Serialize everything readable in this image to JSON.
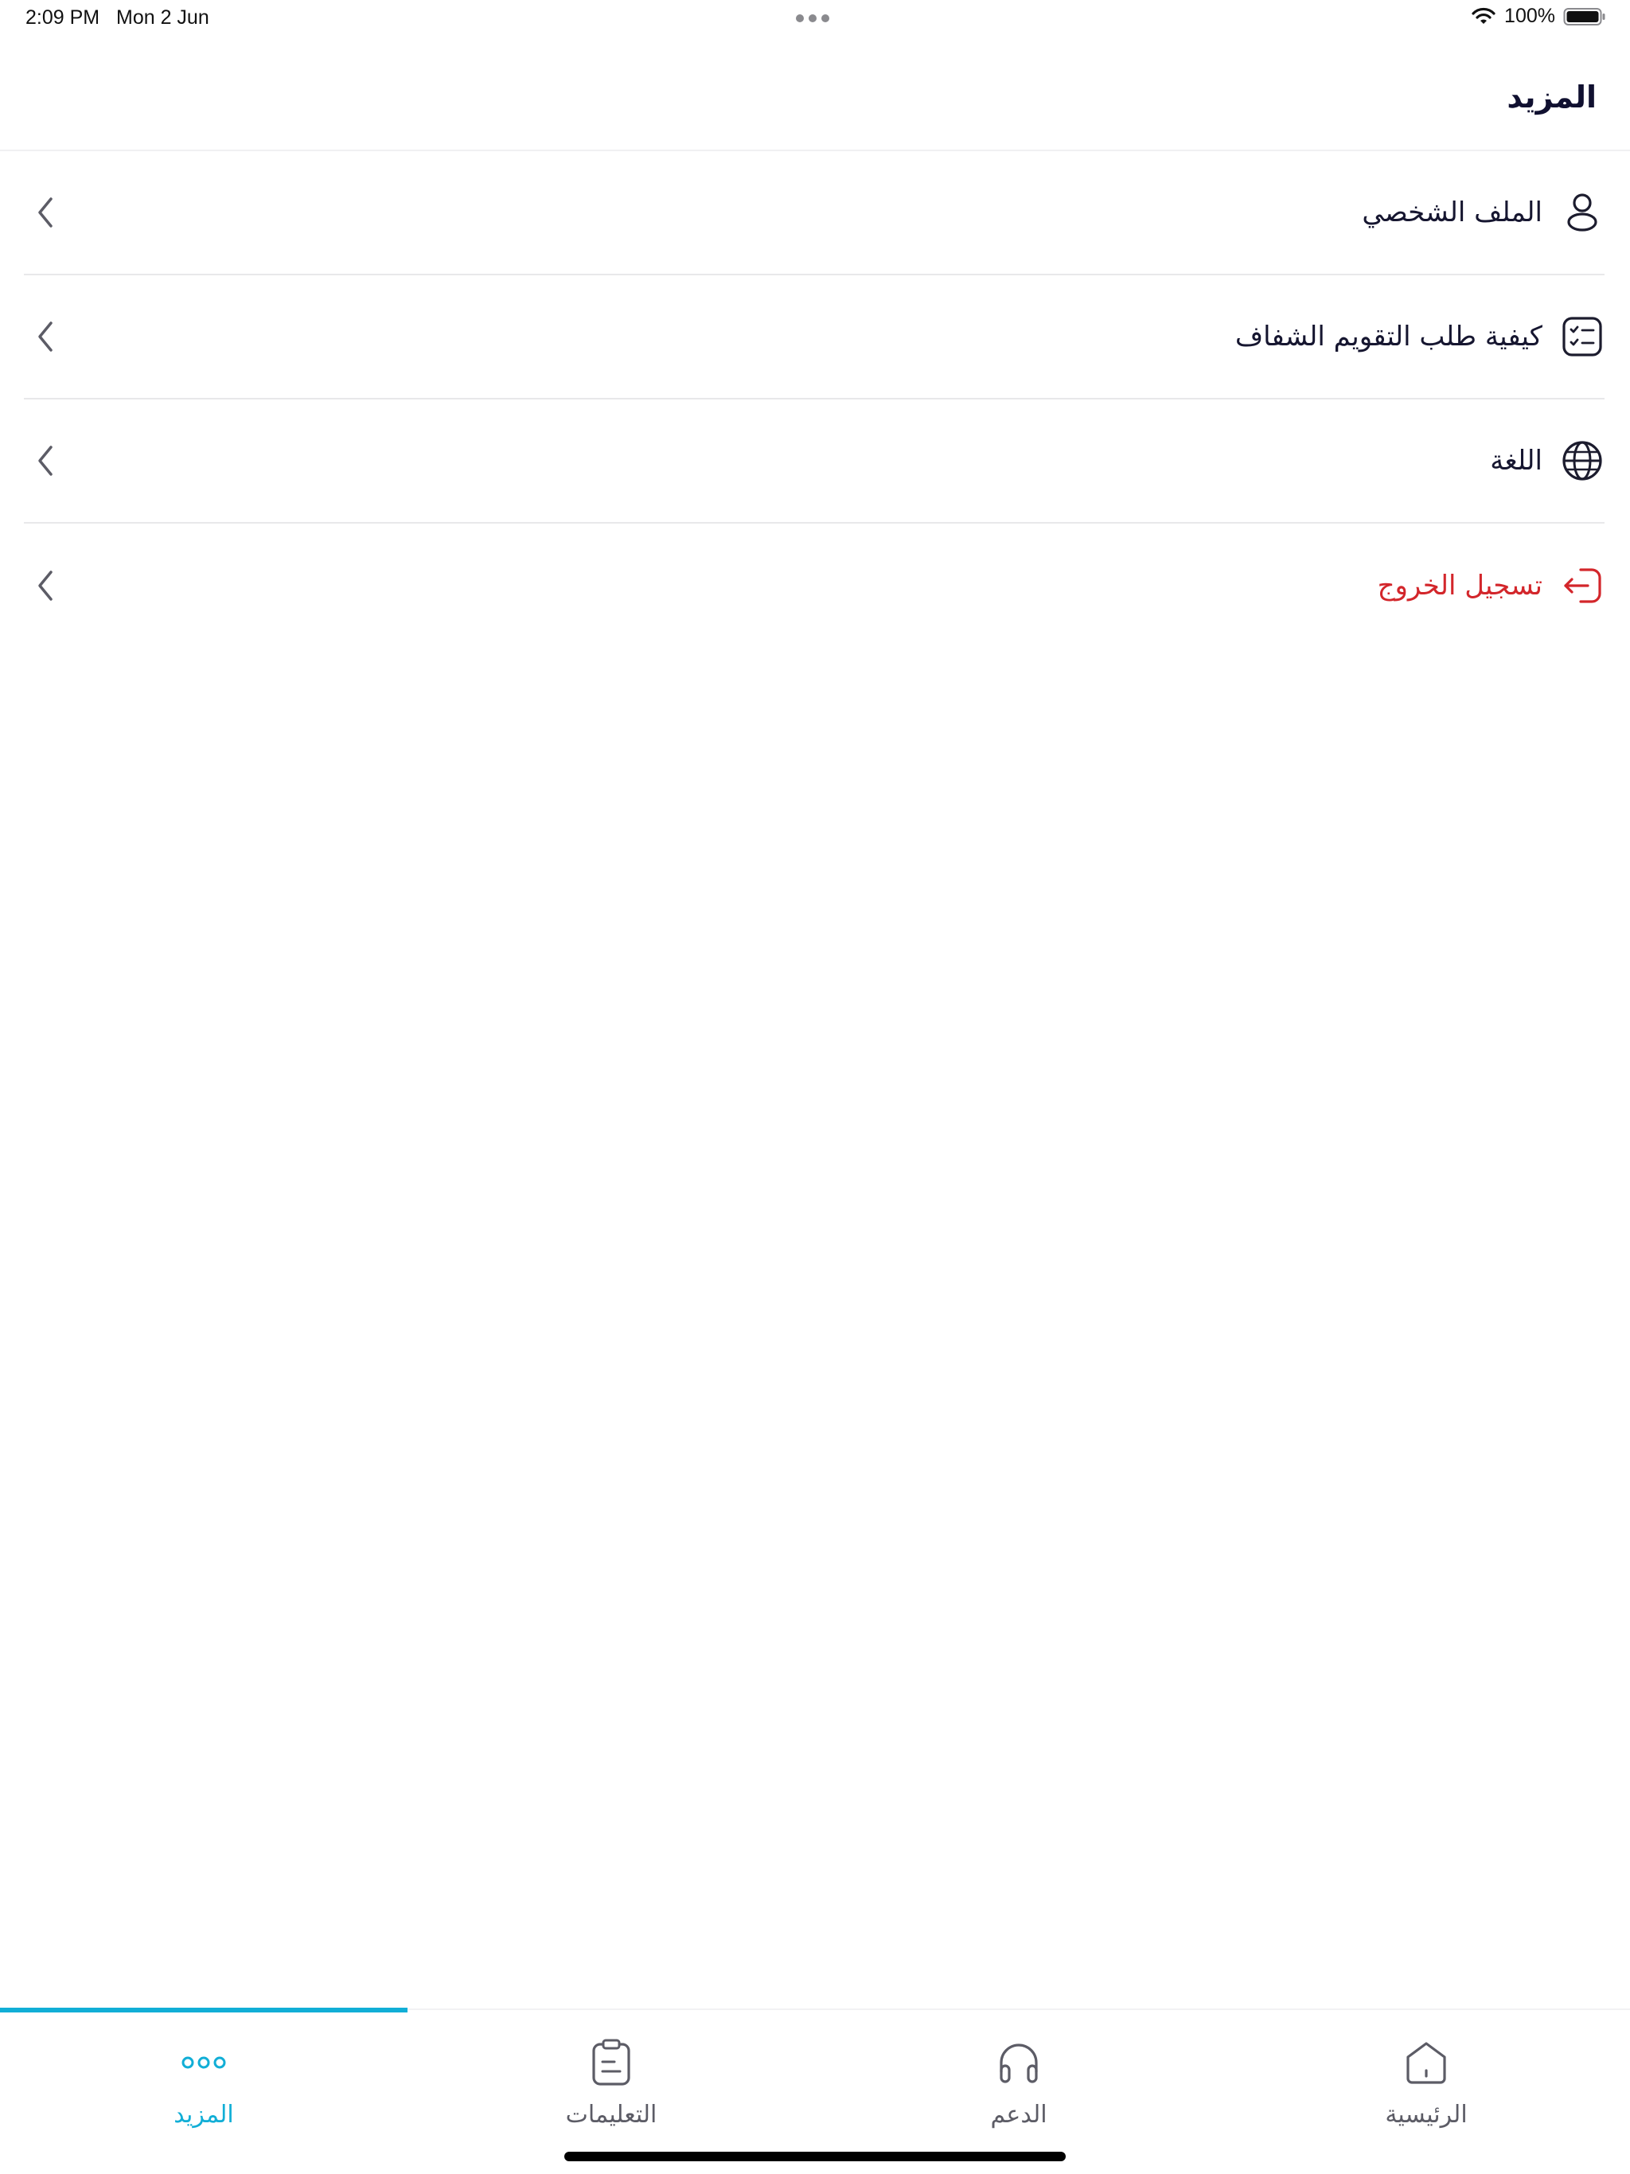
{
  "status_bar": {
    "time": "2:09 PM",
    "date": "Mon 2 Jun",
    "battery": "100%"
  },
  "header": {
    "title": "المزيد"
  },
  "menu": {
    "items": [
      {
        "label": "الملف الشخصي",
        "icon": "user-icon"
      },
      {
        "label": "كيفية طلب التقويم الشفاف",
        "icon": "checklist-icon"
      },
      {
        "label": "اللغة",
        "icon": "globe-icon"
      },
      {
        "label": "تسجيل الخروج",
        "icon": "logout-icon",
        "color": "#d3262b"
      }
    ]
  },
  "tab_bar": {
    "tabs": [
      {
        "label": "المزيد",
        "icon": "more-dots-icon",
        "active": true
      },
      {
        "label": "التعليمات",
        "icon": "clipboard-icon",
        "active": false
      },
      {
        "label": "الدعم",
        "icon": "headphones-icon",
        "active": false
      },
      {
        "label": "الرئيسية",
        "icon": "home-icon",
        "active": false
      }
    ],
    "accent_color": "#11aed6"
  }
}
